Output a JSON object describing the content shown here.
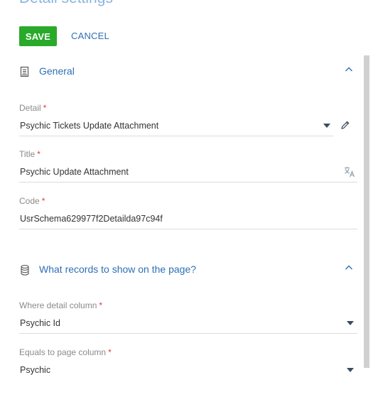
{
  "page": {
    "title": "Detail settings"
  },
  "toolbar": {
    "save_label": "SAVE",
    "cancel_label": "CANCEL",
    "save_color": "#2aaa2a",
    "link_color": "#2f6fb5"
  },
  "sections": [
    {
      "title": "General",
      "icon": "document-icon",
      "expanded": true
    },
    {
      "title": "What records to show on the page?",
      "icon": "database-icon",
      "expanded": true
    }
  ],
  "fields": {
    "detail": {
      "label": "Detail",
      "required_mark": "*",
      "value": "Psychic Tickets Update Attachment"
    },
    "title": {
      "label": "Title",
      "required_mark": "*",
      "value": "Psychic Update Attachment"
    },
    "code": {
      "label": "Code",
      "required_mark": "*",
      "value": "UsrSchema629977f2Detailda97c94f"
    },
    "where_detail_column": {
      "label": "Where detail column",
      "required_mark": "*",
      "value": "Psychic Id"
    },
    "equals_to_page_column": {
      "label": "Equals to page column",
      "required_mark": "*",
      "value": "Psychic"
    }
  }
}
